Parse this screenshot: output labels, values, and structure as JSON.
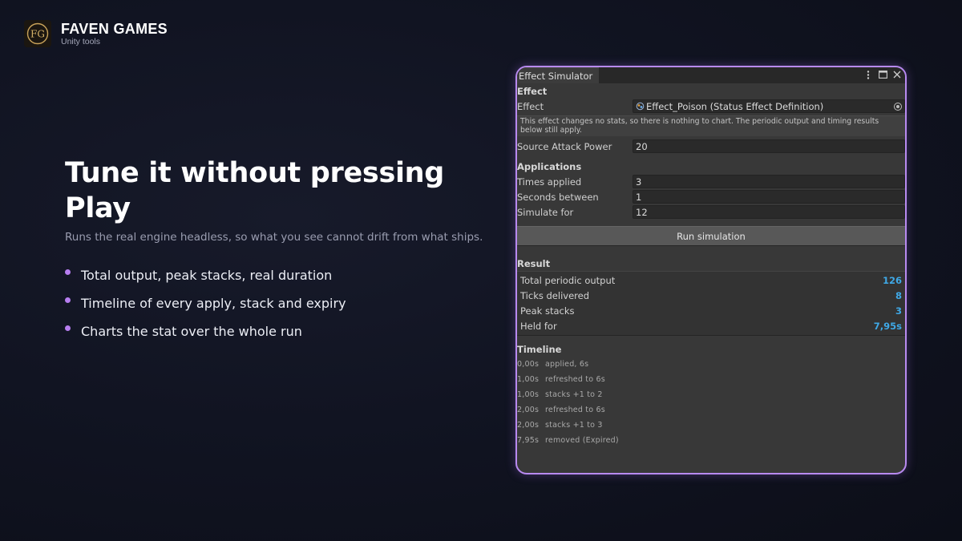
{
  "brand": {
    "name": "FAVEN GAMES",
    "subtitle": "Unity tools",
    "logo_text": "FG"
  },
  "hero": {
    "title": "Tune it without pressing Play",
    "subtitle": "Runs the real engine headless, so what you see cannot drift from what ships.",
    "bullets": [
      "Total output, peak stacks, real duration",
      "Timeline of every apply, stack and expiry",
      "Charts the stat over the whole run"
    ]
  },
  "window": {
    "tab_title": "Effect Simulator",
    "effect_section": "Effect",
    "effect_label": "Effect",
    "effect_value": "Effect_Poison (Status Effect Definition)",
    "help_text": "This effect changes no stats, so there is nothing to chart. The periodic output and timing results below still apply.",
    "source_attack_label": "Source Attack Power",
    "source_attack_value": "20",
    "applications_section": "Applications",
    "times_applied_label": "Times applied",
    "times_applied_value": "3",
    "seconds_between_label": "Seconds between",
    "seconds_between_value": "1",
    "simulate_for_label": "Simulate for",
    "simulate_for_value": "12",
    "run_button": "Run simulation",
    "result_section": "Result",
    "results": [
      {
        "label": "Total periodic output",
        "value": "126"
      },
      {
        "label": "Ticks delivered",
        "value": "8"
      },
      {
        "label": "Peak stacks",
        "value": "3"
      },
      {
        "label": "Held for",
        "value": "7,95s"
      }
    ],
    "timeline_section": "Timeline",
    "timeline": [
      {
        "time": "0,00s",
        "event": "applied, 6s"
      },
      {
        "time": "1,00s",
        "event": "refreshed to 6s"
      },
      {
        "time": "1,00s",
        "event": "stacks +1 to 2"
      },
      {
        "time": "2,00s",
        "event": "refreshed to 6s"
      },
      {
        "time": "2,00s",
        "event": "stacks +1 to 3"
      },
      {
        "time": "7,95s",
        "event": "removed (Expired)"
      }
    ]
  },
  "icons": {
    "menu": "kebab-menu-icon",
    "maximize": "maximize-icon",
    "close": "close-icon",
    "object": "scriptable-object-icon",
    "picker": "object-picker-icon"
  },
  "colors": {
    "accent_purple": "#b88af0",
    "bullet": "#b77ef0",
    "result_value": "#3fa8e6",
    "panel_bg": "#383838",
    "logo_gold": "#c9a35a"
  }
}
